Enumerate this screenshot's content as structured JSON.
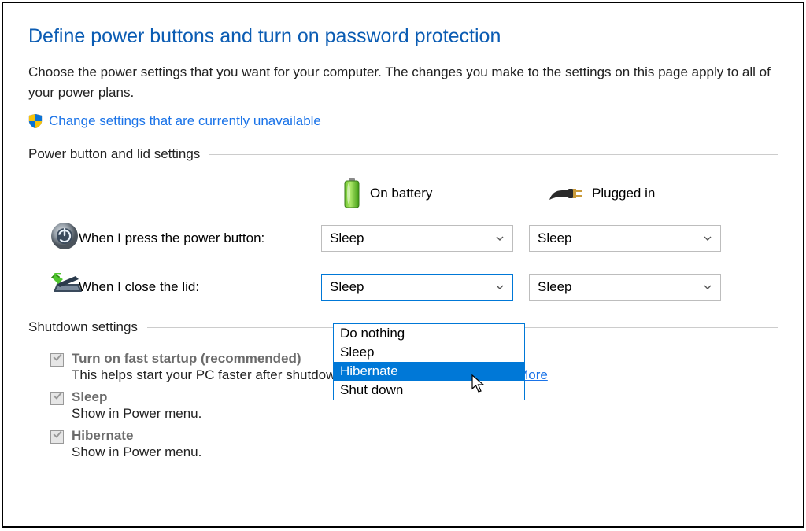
{
  "page": {
    "title": "Define power buttons and turn on password protection",
    "description": "Choose the power settings that you want for your computer. The changes you make to the settings on this page apply to all of your power plans.",
    "change_settings_link": "Change settings that are currently unavailable"
  },
  "power_button_section": {
    "header": "Power button and lid settings",
    "columns": {
      "battery": "On battery",
      "plugged": "Plugged in"
    },
    "rows": [
      {
        "label": "When I press the power button:",
        "battery_value": "Sleep",
        "plugged_value": "Sleep"
      },
      {
        "label": "When I close the lid:",
        "battery_value": "Sleep",
        "plugged_value": "Sleep"
      }
    ],
    "dropdown_options": [
      "Do nothing",
      "Sleep",
      "Hibernate",
      "Shut down"
    ],
    "dropdown_highlighted": "Hibernate"
  },
  "shutdown_section": {
    "header": "Shutdown settings",
    "items": [
      {
        "title": "Turn on fast startup (recommended)",
        "desc": "This helps start your PC faster after shutdown. Restart isn't affected. ",
        "learn_more": "Learn More"
      },
      {
        "title": "Sleep",
        "desc": "Show in Power menu."
      },
      {
        "title": "Hibernate",
        "desc": "Show in Power menu."
      }
    ]
  }
}
